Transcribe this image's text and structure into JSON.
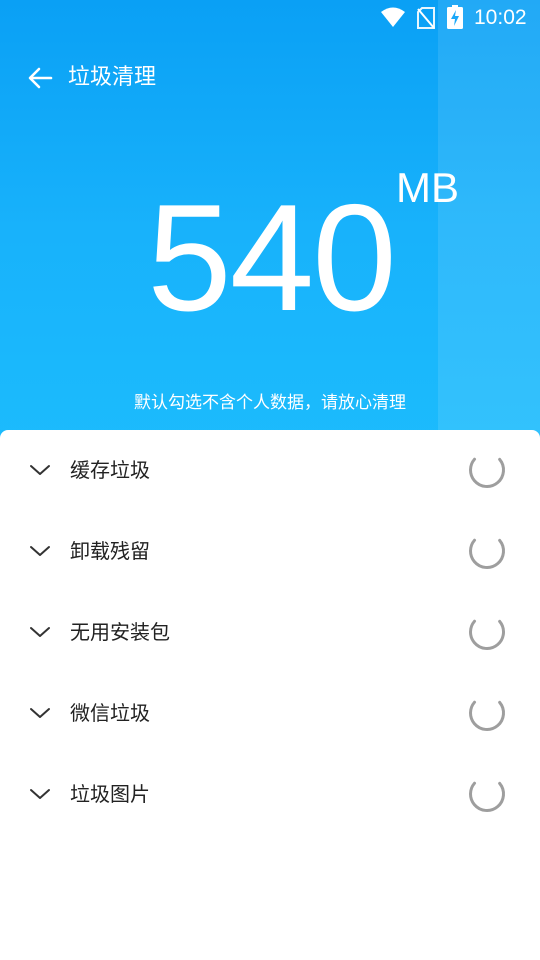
{
  "status_bar": {
    "time": "10:02",
    "icons": [
      "wifi-icon",
      "no-sim-icon",
      "battery-charging-icon"
    ]
  },
  "toolbar": {
    "back_icon": "arrow-left-icon",
    "title": "垃圾清理"
  },
  "summary": {
    "size": "540",
    "unit": "MB",
    "hint": "默认勾选不含个人数据，请放心清理"
  },
  "categories": [
    {
      "label": "缓存垃圾",
      "state": "scanning"
    },
    {
      "label": "卸载残留",
      "state": "scanning"
    },
    {
      "label": "无用安装包",
      "state": "scanning"
    },
    {
      "label": "微信垃圾",
      "state": "scanning"
    },
    {
      "label": "垃圾图片",
      "state": "scanning"
    }
  ],
  "colors": {
    "header_top": "#0aa0f5",
    "header_bottom": "#1cbcfd",
    "text_dark": "#222222",
    "spinner": "#9e9e9e"
  }
}
